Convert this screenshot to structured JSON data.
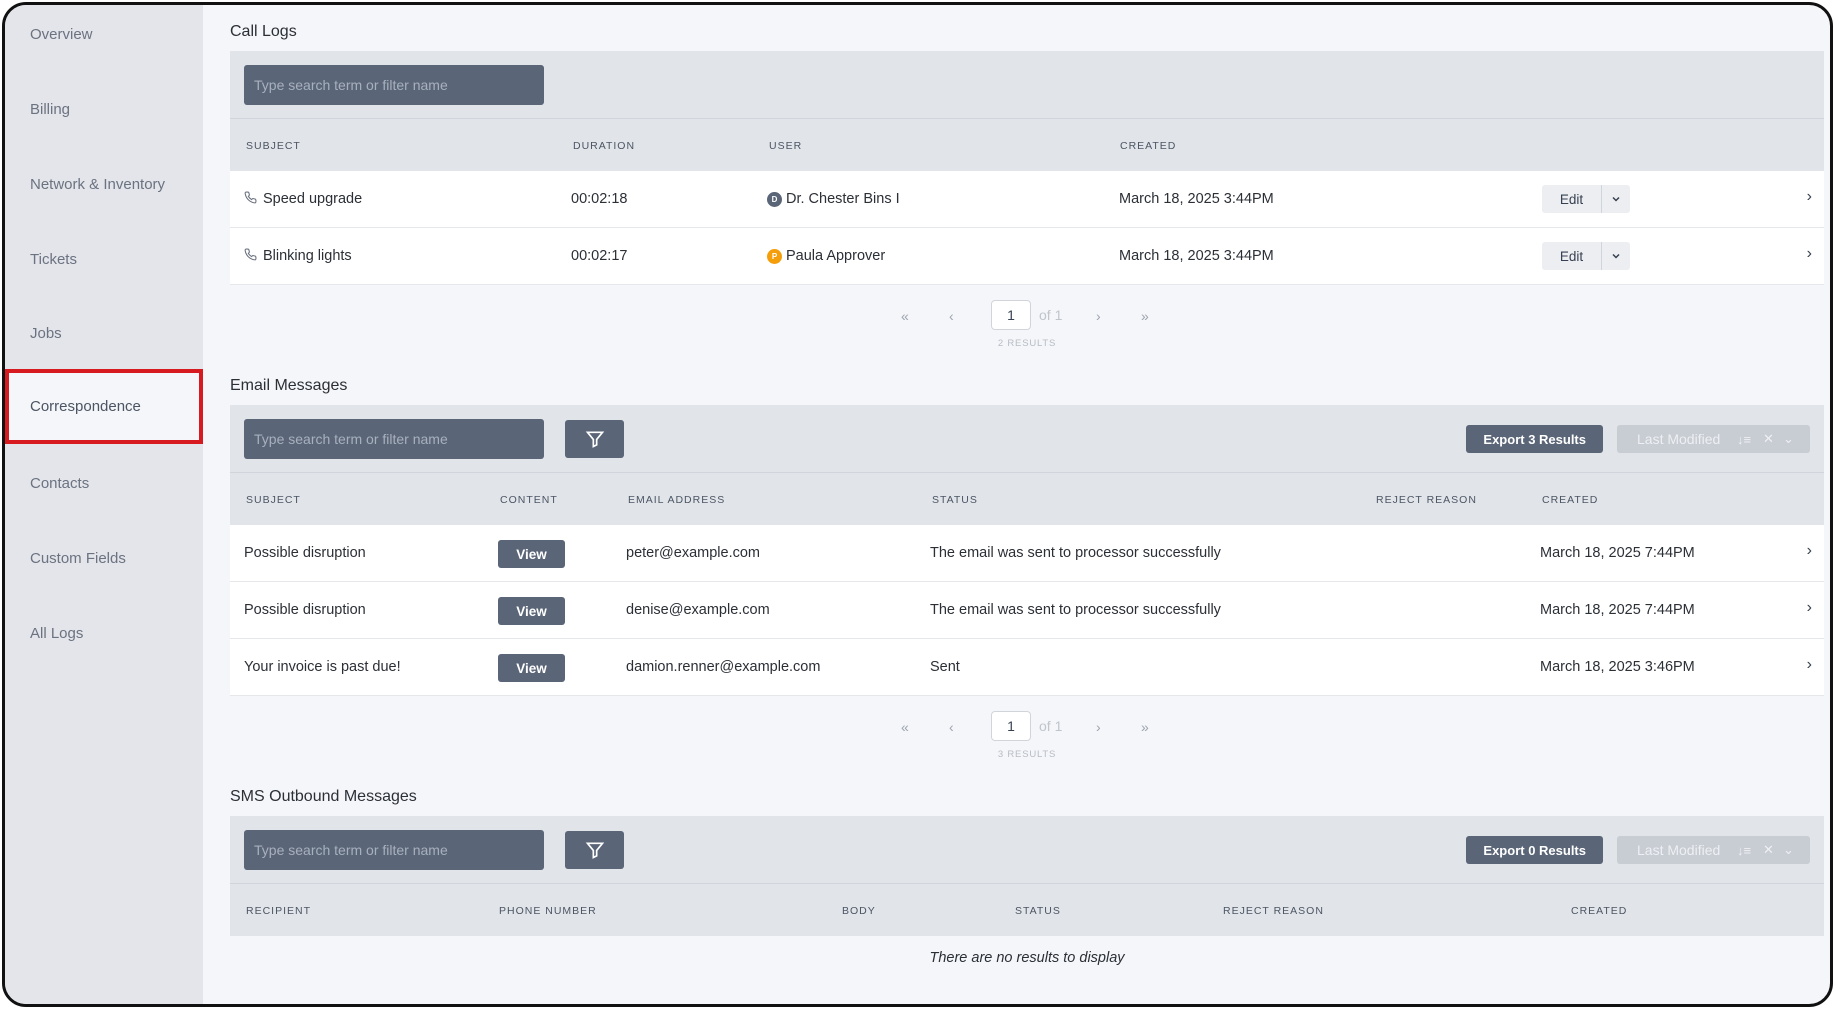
{
  "sidebar": {
    "items": [
      {
        "label": "Overview"
      },
      {
        "label": "Billing"
      },
      {
        "label": "Network & Inventory"
      },
      {
        "label": "Tickets"
      },
      {
        "label": "Jobs"
      },
      {
        "label": "Correspondence",
        "active": true
      },
      {
        "label": "Contacts"
      },
      {
        "label": "Custom Fields"
      },
      {
        "label": "All Logs"
      }
    ]
  },
  "call_logs": {
    "title": "Call Logs",
    "search_placeholder": "Type search term or filter name",
    "columns": [
      "SUBJECT",
      "DURATION",
      "USER",
      "CREATED"
    ],
    "rows": [
      {
        "subject": "Speed upgrade",
        "duration": "00:02:18",
        "user": "Dr. Chester Bins I",
        "user_initial": "D",
        "avatar_color": "#5a6577",
        "created": "March 18, 2025 3:44PM",
        "action": "Edit"
      },
      {
        "subject": "Blinking lights",
        "duration": "00:02:17",
        "user": "Paula Approver",
        "user_initial": "P",
        "avatar_color": "#f59e0b",
        "created": "March 18, 2025 3:44PM",
        "action": "Edit"
      }
    ],
    "pager": {
      "page": "1",
      "of": "of 1",
      "results": "2 RESULTS"
    }
  },
  "email_messages": {
    "title": "Email Messages",
    "search_placeholder": "Type search term or filter name",
    "export_label": "Export 3 Results",
    "sort_label": "Last Modified",
    "columns": [
      "SUBJECT",
      "CONTENT",
      "EMAIL ADDRESS",
      "STATUS",
      "REJECT REASON",
      "CREATED"
    ],
    "rows": [
      {
        "subject": "Possible disruption",
        "content": "View",
        "email": "peter@example.com",
        "status": "The email was sent to processor successfully",
        "reject_reason": "",
        "created": "March 18, 2025 7:44PM"
      },
      {
        "subject": "Possible disruption",
        "content": "View",
        "email": "denise@example.com",
        "status": "The email was sent to processor successfully",
        "reject_reason": "",
        "created": "March 18, 2025 7:44PM"
      },
      {
        "subject": "Your invoice is past due!",
        "content": "View",
        "email": "damion.renner@example.com",
        "status": "Sent",
        "reject_reason": "",
        "created": "March 18, 2025 3:46PM"
      }
    ],
    "pager": {
      "page": "1",
      "of": "of 1",
      "results": "3 RESULTS"
    }
  },
  "sms_messages": {
    "title": "SMS Outbound Messages",
    "search_placeholder": "Type search term or filter name",
    "export_label": "Export 0 Results",
    "sort_label": "Last Modified",
    "columns": [
      "RECIPIENT",
      "PHONE NUMBER",
      "BODY",
      "STATUS",
      "REJECT REASON",
      "CREATED"
    ],
    "empty_text": "There are no results to display"
  },
  "icons": {
    "phone": "phone-icon",
    "filter": "filter-icon",
    "chevron_right": "chevron-right-icon",
    "chevron_down": "chevron-down-icon"
  }
}
